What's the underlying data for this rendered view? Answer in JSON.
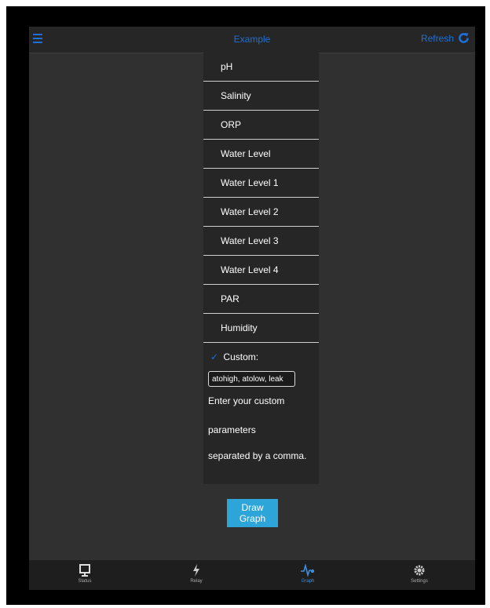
{
  "header": {
    "title": "Example",
    "refresh_label": "Refresh"
  },
  "list": {
    "items": [
      {
        "label": "pH"
      },
      {
        "label": "Salinity"
      },
      {
        "label": "ORP"
      },
      {
        "label": "Water Level"
      },
      {
        "label": "Water Level 1"
      },
      {
        "label": "Water Level 2"
      },
      {
        "label": "Water Level 3"
      },
      {
        "label": "Water Level 4"
      },
      {
        "label": "PAR"
      },
      {
        "label": "Humidity"
      }
    ],
    "custom": {
      "label": "Custom:",
      "checked": true,
      "value": "atohigh, atolow, leak",
      "help_line1": "Enter your custom parameters",
      "help_line2": "separated by a comma."
    }
  },
  "actions": {
    "draw_graph_label": "Draw Graph"
  },
  "tabs": [
    {
      "label": "Status",
      "icon": "monitor-icon",
      "active": false
    },
    {
      "label": "Relay",
      "icon": "lightning-icon",
      "active": false
    },
    {
      "label": "Graph",
      "icon": "pulse-icon",
      "active": true
    },
    {
      "label": "Settings",
      "icon": "gear-icon",
      "active": false
    }
  ],
  "colors": {
    "accent": "#1e6fd6",
    "button": "#2ea5d8",
    "background": "#303030"
  }
}
